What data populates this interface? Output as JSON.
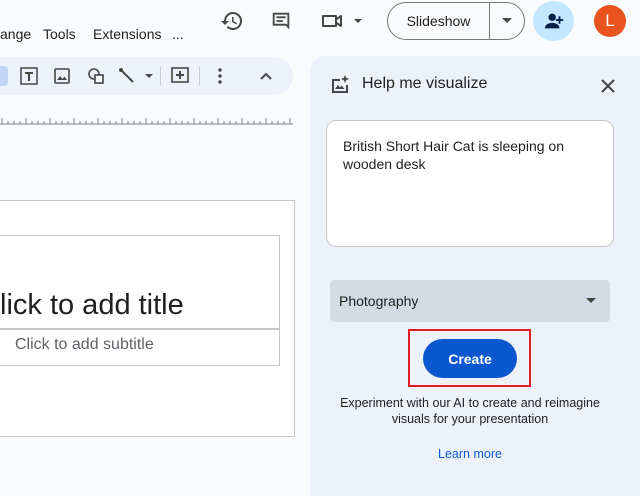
{
  "menu": {
    "items": [
      "ange",
      "Tools",
      "Extensions",
      "..."
    ]
  },
  "header": {
    "slideshow_label": "Slideshow",
    "avatar_initial": "L"
  },
  "slide": {
    "title_placeholder": "lick to add title",
    "subtitle_placeholder": "Click to add subtitle"
  },
  "panel": {
    "title": "Help me visualize",
    "prompt_value": "British Short Hair Cat is sleeping on wooden desk",
    "style_selected": "Photography",
    "create_label": "Create",
    "disclaimer": "Experiment with our AI to create and reimagine visuals for your presentation",
    "learn_more": "Learn more"
  },
  "colors": {
    "accent": "#0b57d0",
    "avatar": "#e8531e",
    "share_bg": "#c2e7ff",
    "highlight": "#e01b24"
  }
}
